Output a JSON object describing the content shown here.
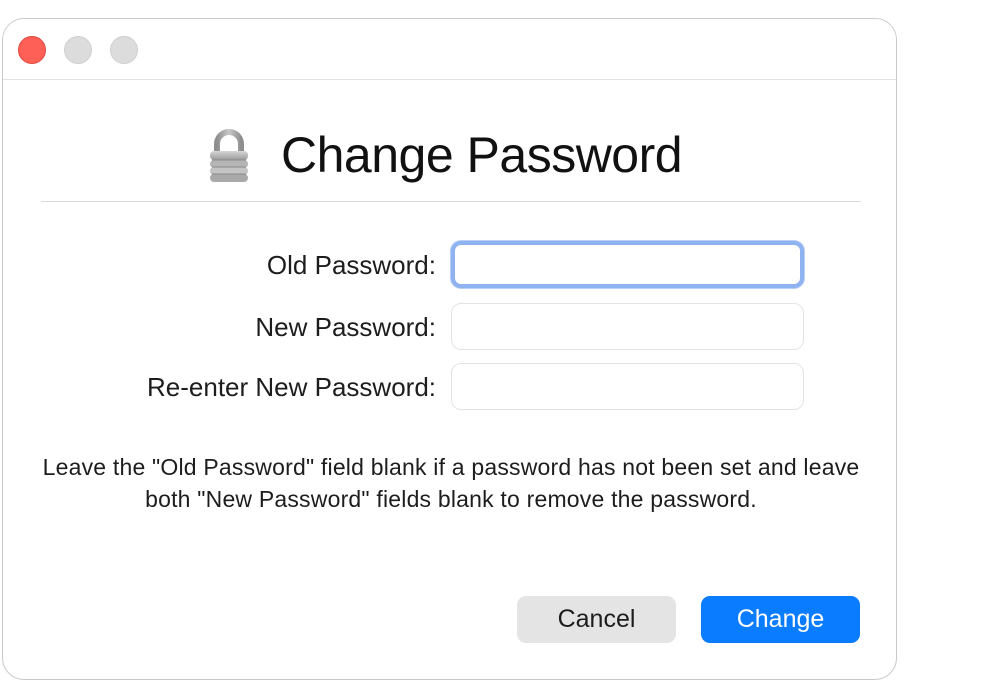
{
  "window": {
    "controls": {
      "close_color": "#fe5f57",
      "minimize_color": "#dcdcdc",
      "zoom_color": "#dcdcdc"
    }
  },
  "dialog": {
    "icon": "lock-icon",
    "title": "Change Password"
  },
  "form": {
    "fields": [
      {
        "label": "Old Password:",
        "value": "",
        "focused": true
      },
      {
        "label": "New Password:",
        "value": ""
      },
      {
        "label": "Re-enter New Password:",
        "value": ""
      }
    ]
  },
  "help_text": "Leave the \"Old Password\" field blank if a password has not been set and leave both \"New Password\" fields blank to remove the password.",
  "buttons": {
    "cancel_label": "Cancel",
    "change_label": "Change",
    "accent_color": "#0a7cff"
  }
}
